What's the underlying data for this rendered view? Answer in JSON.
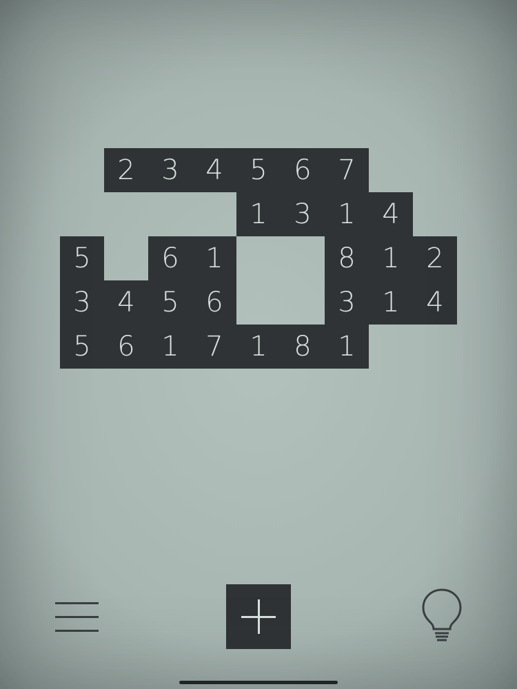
{
  "colors": {
    "background": "#a9b7b3",
    "tile": "#2f3336",
    "tile_text": "#d9e1de",
    "icon": "#3a3f41"
  },
  "board": {
    "rows": [
      [
        "",
        "2",
        "3",
        "4",
        "5",
        "6",
        "7",
        "",
        ""
      ],
      [
        "",
        "",
        "",
        "",
        "1",
        "3",
        "1",
        "4",
        ""
      ],
      [
        "5",
        "",
        "6",
        "1",
        "",
        "",
        "8",
        "1",
        "2"
      ],
      [
        "3",
        "4",
        "5",
        "6",
        "",
        "",
        "3",
        "1",
        "4"
      ],
      [
        "5",
        "6",
        "1",
        "7",
        "1",
        "8",
        "1",
        "",
        ""
      ]
    ]
  },
  "toolbar": {
    "menu_icon": "hamburger-menu-icon",
    "add_icon": "plus-icon",
    "hint_icon": "lightbulb-icon"
  }
}
